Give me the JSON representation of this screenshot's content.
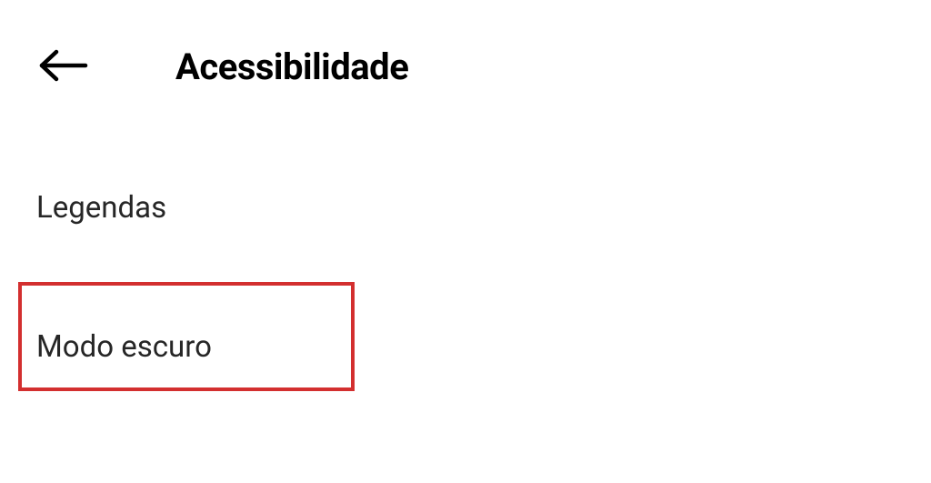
{
  "header": {
    "title": "Acessibilidade"
  },
  "items": {
    "captions": "Legendas",
    "dark_mode": "Modo escuro"
  }
}
